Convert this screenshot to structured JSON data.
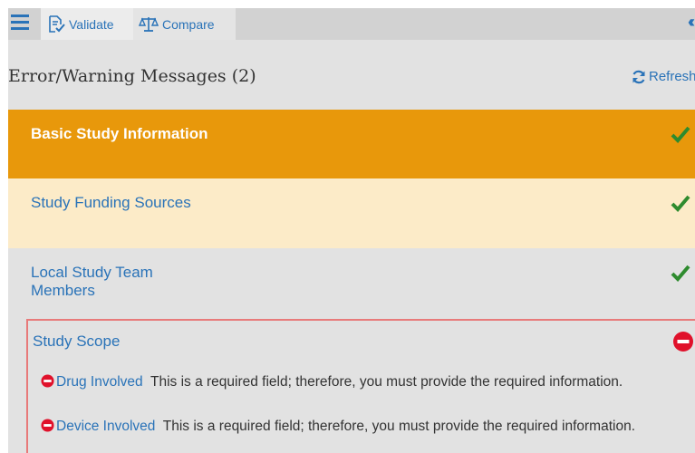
{
  "toolbar": {
    "tabs": [
      {
        "label": "Validate",
        "icon": "validate-document-icon"
      },
      {
        "label": "Compare",
        "icon": "scales-icon"
      }
    ],
    "collapse_icon": "double-chevron-left-icon"
  },
  "panel": {
    "title": "Error/Warning Messages (2)",
    "refresh_label": "Refresh"
  },
  "sections": [
    {
      "label": "Basic Study Information",
      "status": "ok"
    },
    {
      "label": "Study Funding Sources",
      "status": "ok"
    },
    {
      "label": "Local Study Team Members",
      "status": "ok"
    },
    {
      "label": "Study Scope",
      "status": "error"
    }
  ],
  "errors": [
    {
      "field": "Drug Involved",
      "message": "This is a required field; therefore, you must provide the required information."
    },
    {
      "field": "Device Involved",
      "message": "This is a required field; therefore, you must provide the required information."
    }
  ],
  "colors": {
    "accent": "#2a73b8",
    "active_section": "#e8980b",
    "hover_section": "#fcebc8",
    "check": "#2e8b2e",
    "error": "#e0112b"
  }
}
